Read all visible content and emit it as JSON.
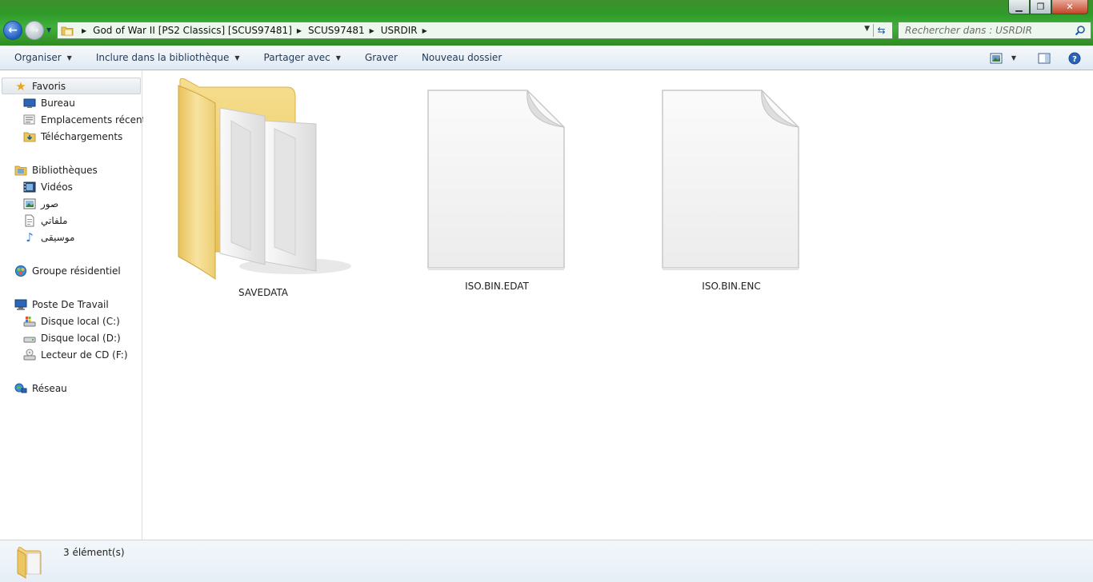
{
  "window": {
    "controls": {
      "minimize": "▁",
      "maximize": "❐",
      "close": "✕"
    }
  },
  "address": {
    "crumbs": [
      "God of War II [PS2 Classics] [SCUS97481]",
      "SCUS97481",
      "USRDIR"
    ]
  },
  "search": {
    "placeholder": "Rechercher dans : USRDIR"
  },
  "toolbar": {
    "organize": "Organiser",
    "include_library": "Inclure dans la bibliothèque",
    "share_with": "Partager avec",
    "burn": "Graver",
    "new_folder": "Nouveau dossier"
  },
  "sidebar": {
    "favorites": {
      "label": "Favoris",
      "items": [
        "Bureau",
        "Emplacements récents",
        "Téléchargements"
      ]
    },
    "libraries": {
      "label": "Bibliothèques",
      "items": [
        "Vidéos",
        "صور",
        "ملفاتي",
        "موسيقى"
      ]
    },
    "homegroup": {
      "label": "Groupe résidentiel"
    },
    "computer": {
      "label": "Poste De Travail",
      "items": [
        "Disque local (C:)",
        "Disque local (D:)",
        "Lecteur de CD (F:)"
      ]
    },
    "network": {
      "label": "Réseau"
    }
  },
  "files": [
    {
      "name": "SAVEDATA",
      "type": "folder"
    },
    {
      "name": "ISO.BIN.EDAT",
      "type": "file"
    },
    {
      "name": "ISO.BIN.ENC",
      "type": "file"
    }
  ],
  "status": {
    "count": "3 élément(s)"
  },
  "colors": {
    "title_green": "#3d8f2c",
    "toolbar_text": "#1e395b",
    "folder_yellow": "#f2d27a"
  }
}
